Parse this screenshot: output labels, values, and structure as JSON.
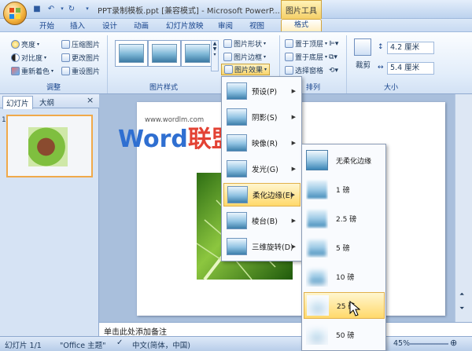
{
  "app": {
    "doc_title": "PPT录制模板.ppt [兼容模式] - Microsoft PowerP...",
    "contextual_tab": "图片工具"
  },
  "tabs": [
    {
      "label": "开始"
    },
    {
      "label": "插入"
    },
    {
      "label": "设计"
    },
    {
      "label": "动画"
    },
    {
      "label": "幻灯片放映"
    },
    {
      "label": "审阅"
    },
    {
      "label": "视图"
    },
    {
      "label": "格式"
    }
  ],
  "ribbon": {
    "adjust": {
      "brightness": "亮度",
      "contrast": "对比度",
      "recolor": "重新着色",
      "compress": "压缩图片",
      "change": "更改图片",
      "reset": "重设图片",
      "label": "调整"
    },
    "styles_label": "图片样式",
    "shape_cmds": {
      "shape": "图片形状",
      "border": "图片边框",
      "effects": "图片效果"
    },
    "arrange": {
      "front": "置于顶层",
      "back": "置于底层",
      "pane": "选择窗格",
      "label": "排列"
    },
    "size": {
      "crop": "裁剪",
      "height": "4.2 厘米",
      "width": "5.4 厘米",
      "label": "大小"
    }
  },
  "panel": {
    "tab_slides": "幻灯片",
    "tab_outline": "大纲",
    "slide_number": "1",
    "close": "×"
  },
  "watermark": {
    "word": "Word",
    "cn": "联盟",
    "url": "www.wordlm.com"
  },
  "notes": "单击此处添加备注",
  "status": {
    "slide": "幻灯片 1/1",
    "theme": "\"Office 主题\"",
    "lang": "中文(简体，中国)",
    "zoom": "45%"
  },
  "effects_menu": {
    "items": [
      {
        "label": "预设(P)",
        "icon": "preset-icon"
      },
      {
        "label": "阴影(S)",
        "icon": "shadow-icon"
      },
      {
        "label": "映像(R)",
        "icon": "reflection-icon"
      },
      {
        "label": "发光(G)",
        "icon": "glow-icon"
      },
      {
        "label": "柔化边缘(E)",
        "icon": "soft-edges-icon",
        "highlighted": true
      },
      {
        "label": "棱台(B)",
        "icon": "bevel-icon"
      },
      {
        "label": "三维旋转(D)",
        "icon": "3d-rotation-icon"
      }
    ]
  },
  "soft_edges_menu": {
    "items": [
      {
        "label": "无柔化边缘",
        "softness": 0
      },
      {
        "label": "1 磅",
        "softness": 1
      },
      {
        "label": "2.5 磅",
        "softness": 2.5
      },
      {
        "label": "5 磅",
        "softness": 5
      },
      {
        "label": "10 磅",
        "softness": 10
      },
      {
        "label": "25 磅",
        "softness": 25,
        "hovered": true
      },
      {
        "label": "50 磅",
        "softness": 50
      }
    ]
  },
  "colors": {
    "accent": "#f5c35b",
    "highlight": "#ffe69b",
    "watermark_blue": "#2f6fd1",
    "watermark_red": "#e34234"
  }
}
